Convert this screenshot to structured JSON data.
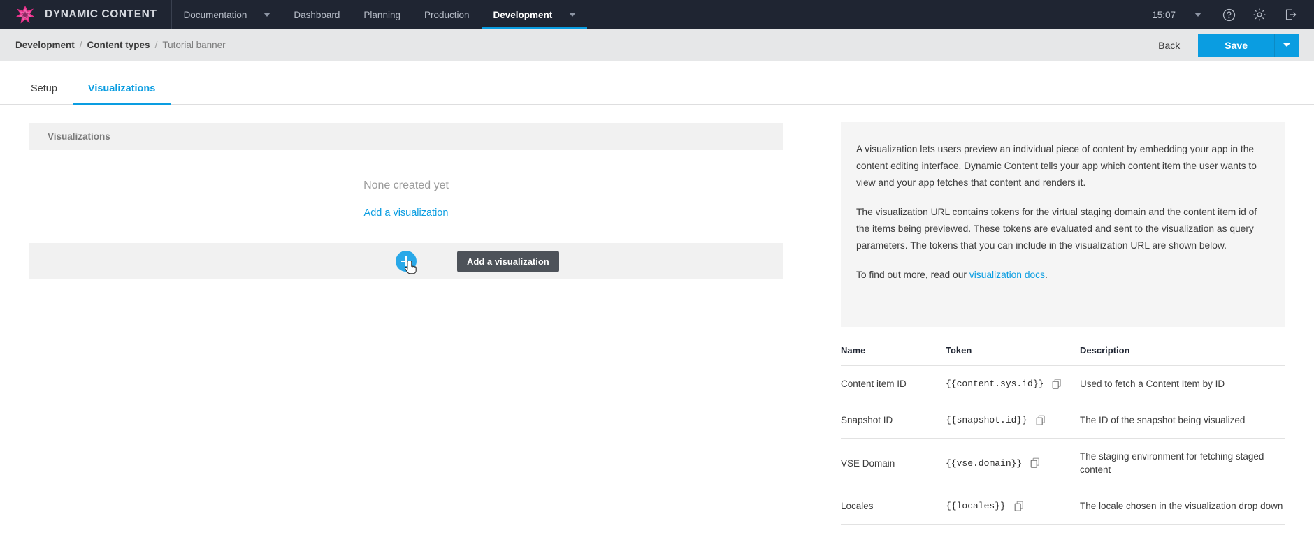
{
  "topnav": {
    "logo_text": "DYNAMIC CONTENT",
    "logo_icon": "starburst-logo-icon",
    "items": [
      {
        "label": "Documentation",
        "has_menu": true,
        "active": false
      },
      {
        "label": "Dashboard",
        "has_menu": false,
        "active": false
      },
      {
        "label": "Planning",
        "has_menu": false,
        "active": false
      },
      {
        "label": "Production",
        "has_menu": false,
        "active": false
      },
      {
        "label": "Development",
        "has_menu": true,
        "active": true
      }
    ],
    "clock": "15:07",
    "clock_caret_icon": "chevron-down-icon",
    "help_icon": "question-circle-icon",
    "settings_icon": "gear-icon",
    "logout_icon": "sign-out-icon"
  },
  "breadcrumb": {
    "items": [
      "Development",
      "Content types",
      "Tutorial banner"
    ],
    "separator": "/"
  },
  "actions": {
    "back_label": "Back",
    "save_label": "Save",
    "save_caret_icon": "chevron-down-icon"
  },
  "tabs": [
    {
      "label": "Setup",
      "active": false
    },
    {
      "label": "Visualizations",
      "active": true
    }
  ],
  "visualizations_panel": {
    "header": "Visualizations",
    "empty_text": "None created yet",
    "empty_link": "Add a visualization",
    "add_button_icon": "plus-icon",
    "add_button_tooltip": "Add a visualization"
  },
  "info": {
    "paragraph_1": "A visualization lets users preview an individual piece of content by embedding your app in the content editing interface. Dynamic Content tells your app which content item the user wants to view and your app fetches that content and renders it.",
    "paragraph_2": "The visualization URL contains tokens for the virtual staging domain and the content item id of the items being previewed. These tokens are evaluated and sent to the visualization as query parameters. The tokens that you can include in the visualization URL are shown below.",
    "paragraph_3_pre": "To find out more, read our ",
    "paragraph_3_link": "visualization docs",
    "paragraph_3_post": "."
  },
  "token_table": {
    "columns": [
      "Name",
      "Token",
      "Description"
    ],
    "copy_icon": "copy-icon",
    "rows": [
      {
        "name": "Content item ID",
        "token": "{{content.sys.id}}",
        "description": "Used to fetch a Content Item by ID"
      },
      {
        "name": "Snapshot ID",
        "token": "{{snapshot.id}}",
        "description": "The ID of the snapshot being visualized"
      },
      {
        "name": "VSE Domain",
        "token": "{{vse.domain}}",
        "description": "The staging environment for fetching staged content"
      },
      {
        "name": "Locales",
        "token": "{{locales}}",
        "description": "The locale chosen in the visualization drop down"
      }
    ]
  },
  "colors": {
    "accent": "#0a9de1",
    "nav_bg": "#1f2532",
    "crumb_bg": "#e6e7e8",
    "panel_bg": "#f5f5f5",
    "section_bg": "#f1f1f1",
    "logo_pink": "#e8308a",
    "tooltip_bg": "#4d5259"
  }
}
